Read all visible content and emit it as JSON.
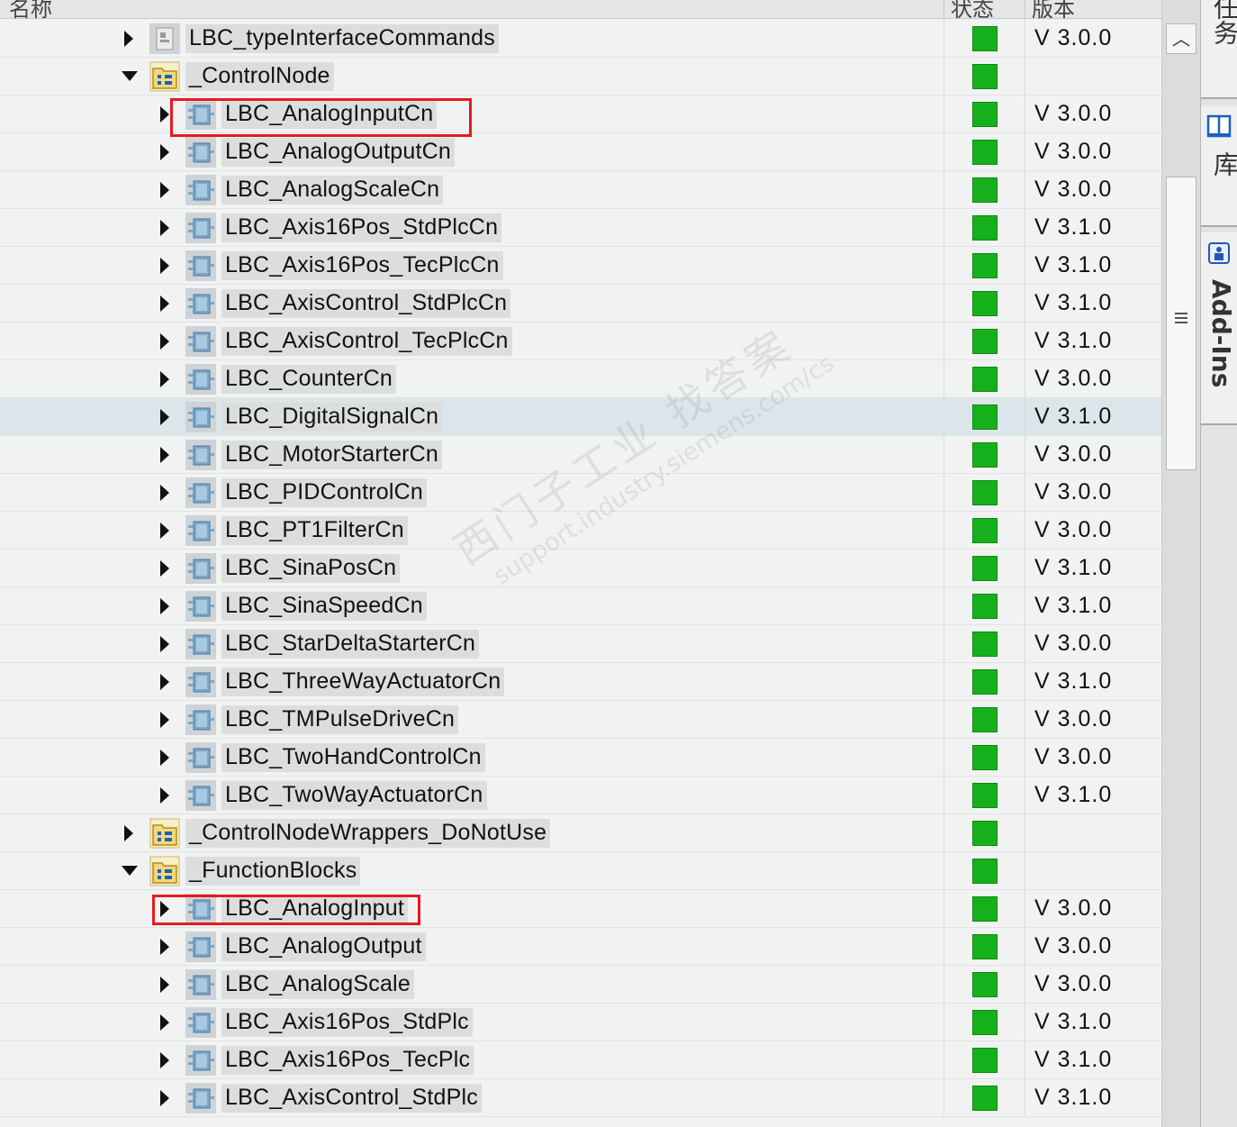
{
  "header": {
    "col_name": "名称",
    "col_status": "状态",
    "col_version": "版本"
  },
  "rows": [
    {
      "label": "LBC_typeInterfaceCommands",
      "version": "V 3.0.0",
      "icon": "type-interface-icon",
      "level": 0,
      "arrow": "collapsed"
    },
    {
      "label": "_ControlNode",
      "version": "",
      "icon": "folder-icon",
      "level": 0,
      "arrow": "expanded"
    },
    {
      "label": "LBC_AnalogInputCn",
      "version": "V 3.0.0",
      "icon": "block-icon",
      "level": 1,
      "arrow": "collapsed"
    },
    {
      "label": "LBC_AnalogOutputCn",
      "version": "V 3.0.0",
      "icon": "block-icon",
      "level": 1,
      "arrow": "collapsed"
    },
    {
      "label": "LBC_AnalogScaleCn",
      "version": "V 3.0.0",
      "icon": "block-icon",
      "level": 1,
      "arrow": "collapsed"
    },
    {
      "label": "LBC_Axis16Pos_StdPlcCn",
      "version": "V 3.1.0",
      "icon": "block-icon",
      "level": 1,
      "arrow": "collapsed"
    },
    {
      "label": "LBC_Axis16Pos_TecPlcCn",
      "version": "V 3.1.0",
      "icon": "block-icon",
      "level": 1,
      "arrow": "collapsed"
    },
    {
      "label": "LBC_AxisControl_StdPlcCn",
      "version": "V 3.1.0",
      "icon": "block-icon",
      "level": 1,
      "arrow": "collapsed"
    },
    {
      "label": "LBC_AxisControl_TecPlcCn",
      "version": "V 3.1.0",
      "icon": "block-icon",
      "level": 1,
      "arrow": "collapsed"
    },
    {
      "label": "LBC_CounterCn",
      "version": "V 3.0.0",
      "icon": "block-icon",
      "level": 1,
      "arrow": "collapsed"
    },
    {
      "label": "LBC_DigitalSignalCn",
      "version": "V 3.1.0",
      "icon": "block-icon",
      "level": 1,
      "arrow": "collapsed",
      "selected": true
    },
    {
      "label": "LBC_MotorStarterCn",
      "version": "V 3.0.0",
      "icon": "block-icon",
      "level": 1,
      "arrow": "collapsed"
    },
    {
      "label": "LBC_PIDControlCn",
      "version": "V 3.0.0",
      "icon": "block-icon",
      "level": 1,
      "arrow": "collapsed"
    },
    {
      "label": "LBC_PT1FilterCn",
      "version": "V 3.0.0",
      "icon": "block-icon",
      "level": 1,
      "arrow": "collapsed"
    },
    {
      "label": "LBC_SinaPosCn",
      "version": "V 3.1.0",
      "icon": "block-icon",
      "level": 1,
      "arrow": "collapsed"
    },
    {
      "label": "LBC_SinaSpeedCn",
      "version": "V 3.1.0",
      "icon": "block-icon",
      "level": 1,
      "arrow": "collapsed"
    },
    {
      "label": "LBC_StarDeltaStarterCn",
      "version": "V 3.0.0",
      "icon": "block-icon",
      "level": 1,
      "arrow": "collapsed"
    },
    {
      "label": "LBC_ThreeWayActuatorCn",
      "version": "V 3.1.0",
      "icon": "block-icon",
      "level": 1,
      "arrow": "collapsed"
    },
    {
      "label": "LBC_TMPulseDriveCn",
      "version": "V 3.0.0",
      "icon": "block-icon",
      "level": 1,
      "arrow": "collapsed"
    },
    {
      "label": "LBC_TwoHandControlCn",
      "version": "V 3.0.0",
      "icon": "block-icon",
      "level": 1,
      "arrow": "collapsed"
    },
    {
      "label": "LBC_TwoWayActuatorCn",
      "version": "V 3.1.0",
      "icon": "block-icon",
      "level": 1,
      "arrow": "collapsed"
    },
    {
      "label": "_ControlNodeWrappers_DoNotUse",
      "version": "",
      "icon": "folder-icon",
      "level": 0,
      "arrow": "collapsed"
    },
    {
      "label": "_FunctionBlocks",
      "version": "",
      "icon": "folder-icon",
      "level": 0,
      "arrow": "expanded"
    },
    {
      "label": "LBC_AnalogInput",
      "version": "V 3.0.0",
      "icon": "block-icon",
      "level": 1,
      "arrow": "collapsed"
    },
    {
      "label": "LBC_AnalogOutput",
      "version": "V 3.0.0",
      "icon": "block-icon",
      "level": 1,
      "arrow": "collapsed"
    },
    {
      "label": "LBC_AnalogScale",
      "version": "V 3.0.0",
      "icon": "block-icon",
      "level": 1,
      "arrow": "collapsed"
    },
    {
      "label": "LBC_Axis16Pos_StdPlc",
      "version": "V 3.1.0",
      "icon": "block-icon",
      "level": 1,
      "arrow": "collapsed"
    },
    {
      "label": "LBC_Axis16Pos_TecPlc",
      "version": "V 3.1.0",
      "icon": "block-icon",
      "level": 1,
      "arrow": "collapsed"
    },
    {
      "label": "LBC_AxisControl_StdPlc",
      "version": "V 3.1.0",
      "icon": "block-icon",
      "level": 1,
      "arrow": "collapsed"
    }
  ],
  "status_color": "#16b01c",
  "highlight_color": "#e8191d",
  "watermark": {
    "line1": "西门子工业 找答案",
    "line2": "support.industry.siemens.com/cs"
  },
  "side_tabs": {
    "tasks_label": "任务",
    "library_label": "库",
    "addins_label": "Add-Ins"
  },
  "scrollbar": {
    "up_glyph": "︿"
  }
}
